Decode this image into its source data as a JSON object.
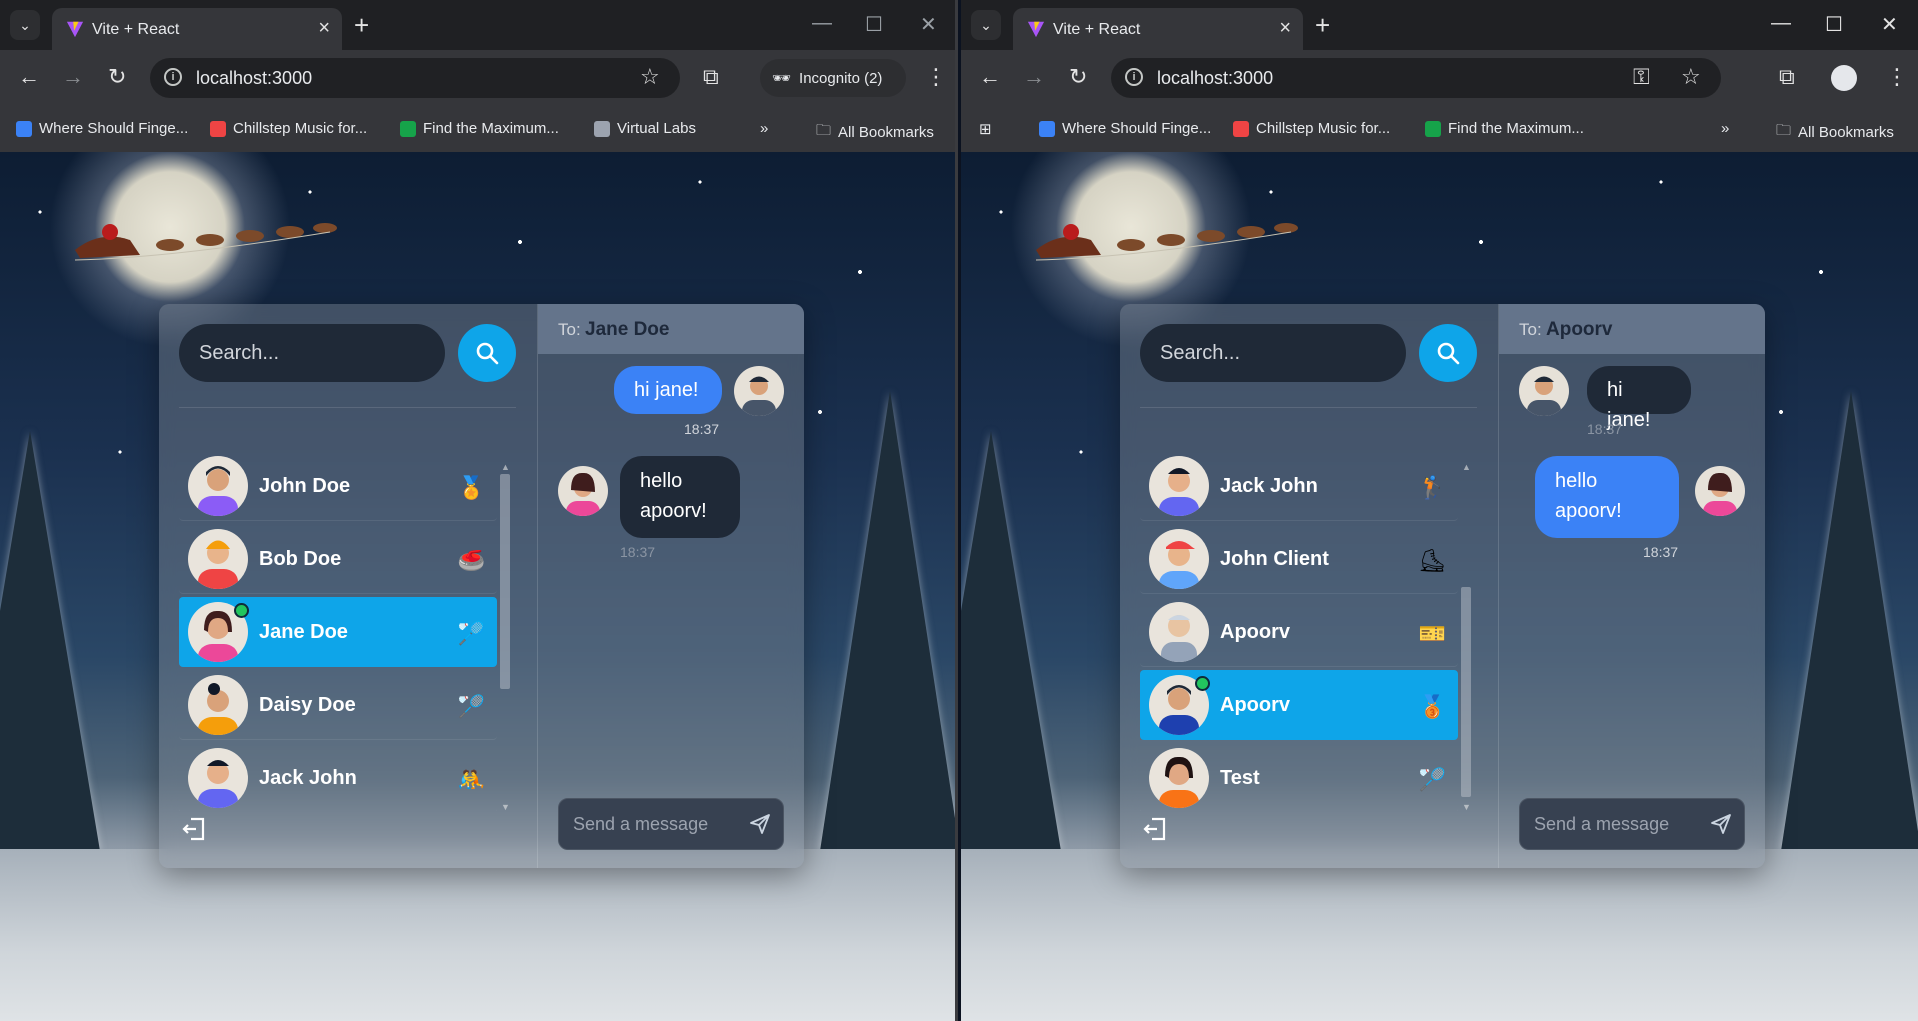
{
  "windows": [
    {
      "tab_title": "Vite + React",
      "url": "localhost:3000",
      "profile_badge": "Incognito (2)",
      "bookmarks": [
        "Where Should Finge...",
        "Chillstep Music for...",
        "Find the Maximum...",
        "Virtual Labs"
      ],
      "bookmarks_folder": "All Bookmarks",
      "search_placeholder": "Search...",
      "conversations": [
        {
          "name": "John Doe",
          "emoji": "🏅",
          "selected": false,
          "online": false,
          "avatar_color": "#8b5cf6"
        },
        {
          "name": "Bob Doe",
          "emoji": "🥌",
          "selected": false,
          "online": false,
          "avatar_color": "#ef4444"
        },
        {
          "name": "Jane Doe",
          "emoji": "🏸",
          "selected": true,
          "online": true,
          "avatar_color": "#ec4899"
        },
        {
          "name": "Daisy Doe",
          "emoji": "🏸",
          "selected": false,
          "online": false,
          "avatar_color": "#f59e0b"
        },
        {
          "name": "Jack John",
          "emoji": "🤼",
          "selected": false,
          "online": false,
          "avatar_color": "#6366f1"
        }
      ],
      "chat": {
        "to_label": "To:",
        "to_name": "Jane Doe",
        "messages": [
          {
            "text": "hi jane!",
            "time": "18:37",
            "from_me": true
          },
          {
            "text": "hello apoorv!",
            "time": "18:37",
            "from_me": false
          }
        ],
        "input_placeholder": "Send a message"
      }
    },
    {
      "tab_title": "Vite + React",
      "url": "localhost:3000",
      "bookmarks": [
        "Where Should Finge...",
        "Chillstep Music for...",
        "Find the Maximum..."
      ],
      "bookmarks_folder": "All Bookmarks",
      "search_placeholder": "Search...",
      "conversations": [
        {
          "name": "Jack John",
          "emoji": "🏌",
          "selected": false,
          "online": false,
          "avatar_color": "#6366f1"
        },
        {
          "name": "John Client",
          "emoji": "⛸",
          "selected": false,
          "online": false,
          "avatar_color": "#ef4444"
        },
        {
          "name": "Apoorv",
          "emoji": "🎫",
          "selected": false,
          "online": false,
          "avatar_color": "#94a3b8"
        },
        {
          "name": "Apoorv",
          "emoji": "🥉",
          "selected": true,
          "online": true,
          "avatar_color": "#1e40af"
        },
        {
          "name": "Test",
          "emoji": "🏸",
          "selected": false,
          "online": false,
          "avatar_color": "#f97316"
        }
      ],
      "chat": {
        "to_label": "To:",
        "to_name": "Apoorv",
        "messages": [
          {
            "text": "hi jane!",
            "time": "18:37",
            "from_me": false
          },
          {
            "text": "hello apoorv!",
            "time": "18:37",
            "from_me": true
          }
        ],
        "input_placeholder": "Send a message"
      }
    }
  ],
  "colors": {
    "accent": "#0ea5e9",
    "bubble_mine": "#3b82f6",
    "bubble_theirs": "#1f2937",
    "online": "#22c55e"
  }
}
